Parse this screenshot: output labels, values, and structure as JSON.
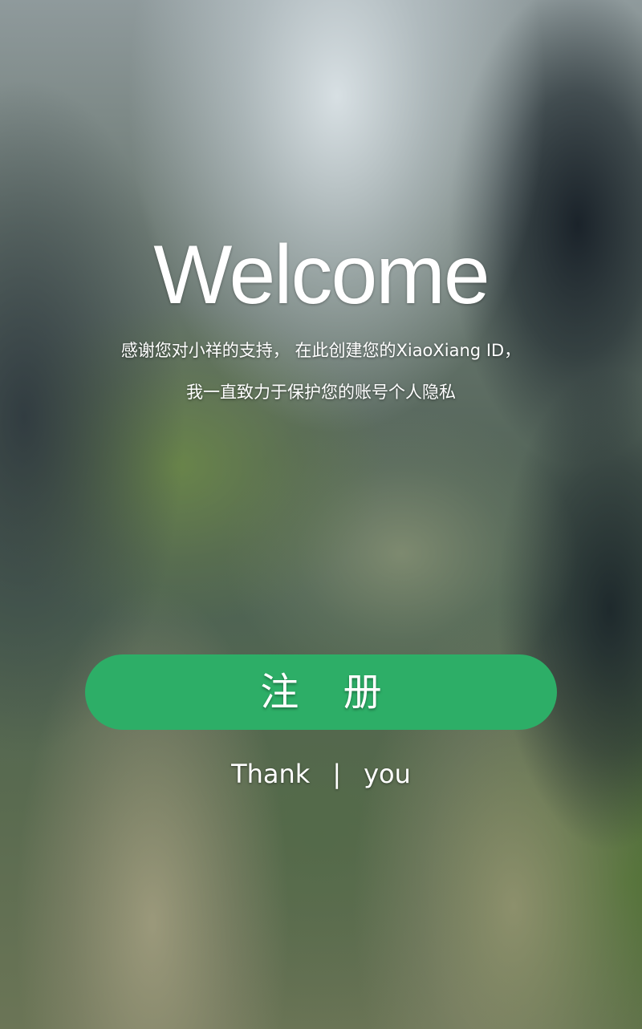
{
  "welcome_title": "Welcome",
  "subtitle_line1": "感谢您对小祥的支持， 在此创建您的XiaoXiang ID，",
  "subtitle_line2": "我一直致力于保护您的账号个人隐私",
  "register_button": {
    "label": "注 册",
    "color": "#2dae67"
  },
  "footer": {
    "left": "Thank",
    "separator": "|",
    "right": "you"
  }
}
